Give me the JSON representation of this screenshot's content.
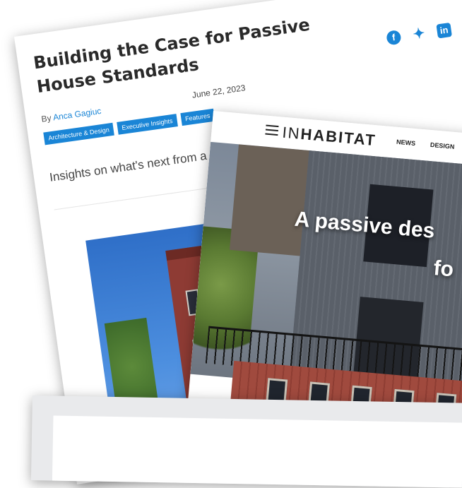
{
  "article": {
    "title": "Building the Case for Passive House Standards",
    "byline_prefix": "By",
    "author": "Anca Gagiuc",
    "date": "June 22, 2023",
    "tags": [
      "Architecture & Design",
      "Executive Insights",
      "Features"
    ],
    "subtitle": "Insights on what's next from a leading expert in the U.S.",
    "social_icons": [
      "facebook-icon",
      "twitter-icon",
      "linkedin-icon"
    ]
  },
  "inhabitat": {
    "logo_light": "IN",
    "logo_bold": "HABITAT",
    "nav": [
      "NEWS",
      "DESIGN"
    ],
    "headline_line1": "A passive des",
    "headline_line2": "fo"
  },
  "colors": {
    "accent": "#1a85d6",
    "title_text": "#2a2a2a",
    "brick": "#8e3b34"
  }
}
